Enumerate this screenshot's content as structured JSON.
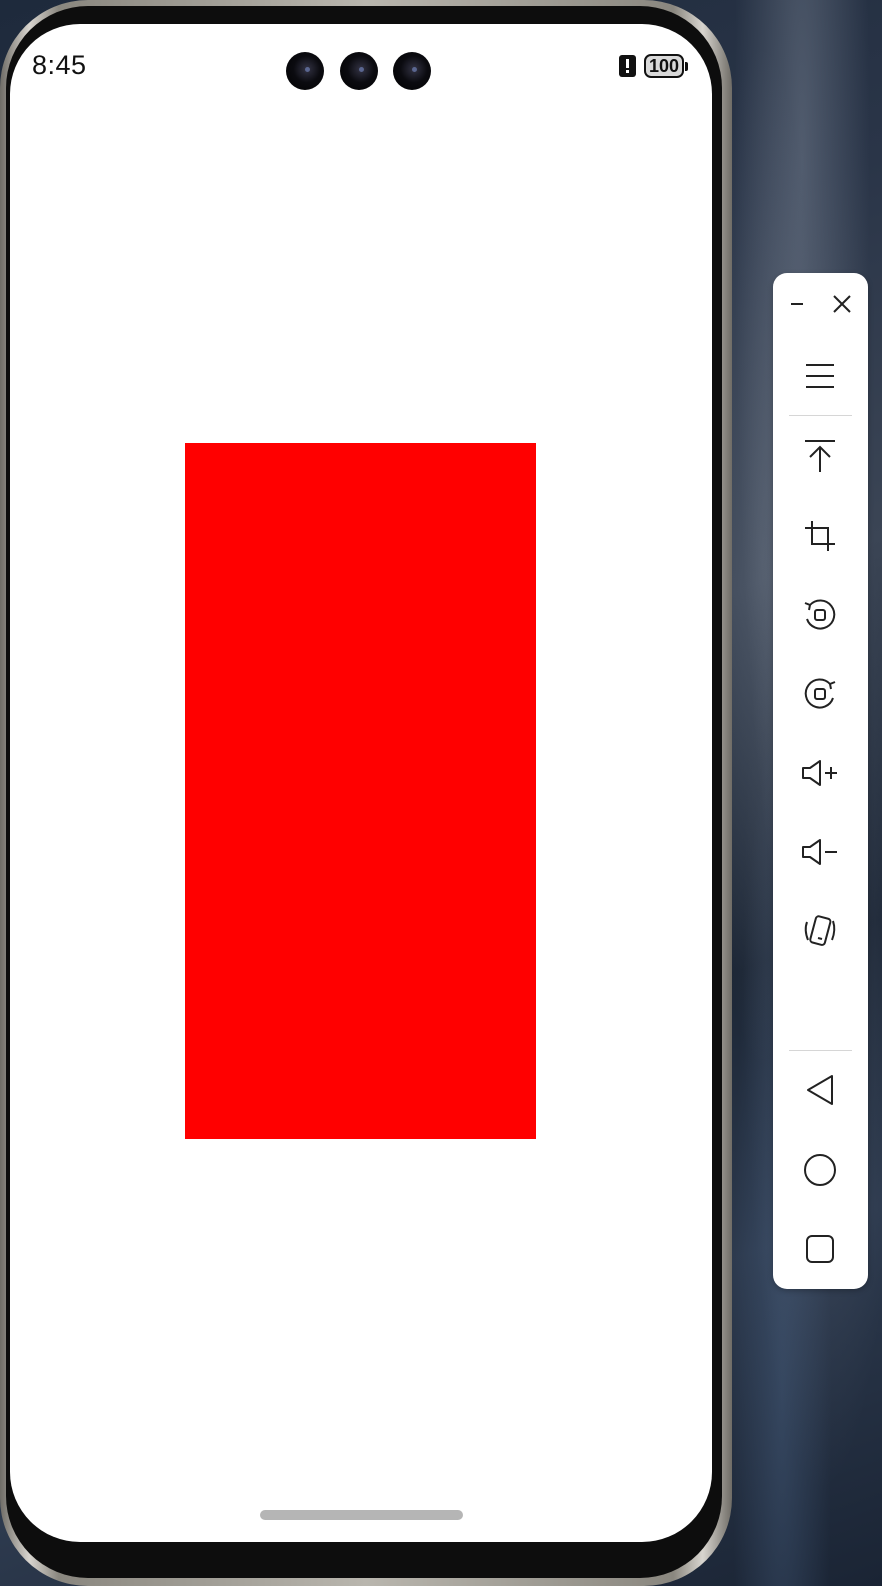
{
  "status_bar": {
    "time": "8:45",
    "battery": "100",
    "alert_icon": "alert-icon"
  },
  "app": {
    "rectangle_color": "#FF0000",
    "background_color": "#FFFFFF"
  },
  "toolbar": {
    "window_controls": [
      "minimize-icon",
      "close-icon"
    ],
    "tools": [
      "menu-icon",
      "pin-to-top-icon",
      "crop-icon",
      "rotate-left-icon",
      "rotate-right-icon",
      "volume-up-icon",
      "volume-down-icon",
      "shake-icon"
    ],
    "navigation": [
      "back-icon",
      "home-icon",
      "recents-icon"
    ]
  }
}
